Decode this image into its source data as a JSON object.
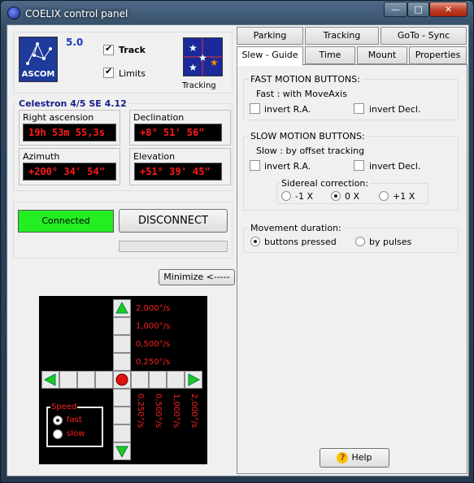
{
  "window": {
    "title": "COELIX control panel",
    "minimize_glyph": "—",
    "maximize_glyph": "□",
    "close_glyph": "✕"
  },
  "header": {
    "logo_text": "ASCOM",
    "version": "5.0",
    "track_label": "Track",
    "track_checked": true,
    "limits_label": "Limits",
    "limits_checked": true,
    "tracking_icon_label": "Tracking"
  },
  "telescope": {
    "group_title": "Celestron 4/5 SE 4.12",
    "ra_label": "Right ascension",
    "ra_value": "19h 53m 55,3s",
    "dec_label": "Declination",
    "dec_value": "+8° 51' 56\"",
    "az_label": "Azimuth",
    "az_value": "+200° 34' 54\"",
    "el_label": "Elevation",
    "el_value": "+51° 39' 45\""
  },
  "connection": {
    "status": "Connected",
    "status_color": "#22ee22",
    "disconnect_label": "DISCONNECT"
  },
  "minimize_button": "Minimize <-----",
  "pad": {
    "speeds_up": [
      "2,000°/s",
      "1,000°/s",
      "0,500°/s",
      "0,250°/s"
    ],
    "speeds_down": [
      "0,250°/s",
      "0,500°/s",
      "1,000°/s",
      "2,000°/s"
    ],
    "speed_group": "Speed",
    "fast_label": "fast",
    "fast_selected": true,
    "slow_label": "slow",
    "slow_selected": false
  },
  "tabs": {
    "row1": [
      "Parking",
      "Tracking",
      "GoTo - Sync"
    ],
    "row2": [
      "Slew - Guide",
      "Time",
      "Mount",
      "Properties"
    ],
    "selected": "Slew - Guide"
  },
  "fast_motion": {
    "title": "FAST MOTION BUTTONS:",
    "desc": "Fast : with MoveAxis",
    "invert_ra": "invert R.A.",
    "invert_dec": "invert Decl."
  },
  "slow_motion": {
    "title": "SLOW MOTION BUTTONS:",
    "desc": "Slow : by offset tracking",
    "invert_ra": "invert R.A.",
    "invert_dec": "invert Decl.",
    "sidereal_title": "Sidereal correction:",
    "options": [
      "-1 X",
      "0 X",
      "+1 X"
    ],
    "selected": "0 X"
  },
  "movement": {
    "title": "Movement duration:",
    "pressed_label": "buttons pressed",
    "pulses_label": "by pulses",
    "selected": "buttons pressed"
  },
  "help_label": "Help",
  "icons": {
    "up": "green-up-arrow-icon",
    "down": "green-down-arrow-icon",
    "left": "green-left-arrow-icon",
    "right": "green-right-arrow-icon",
    "stop": "red-stop-icon",
    "help": "question-icon"
  }
}
